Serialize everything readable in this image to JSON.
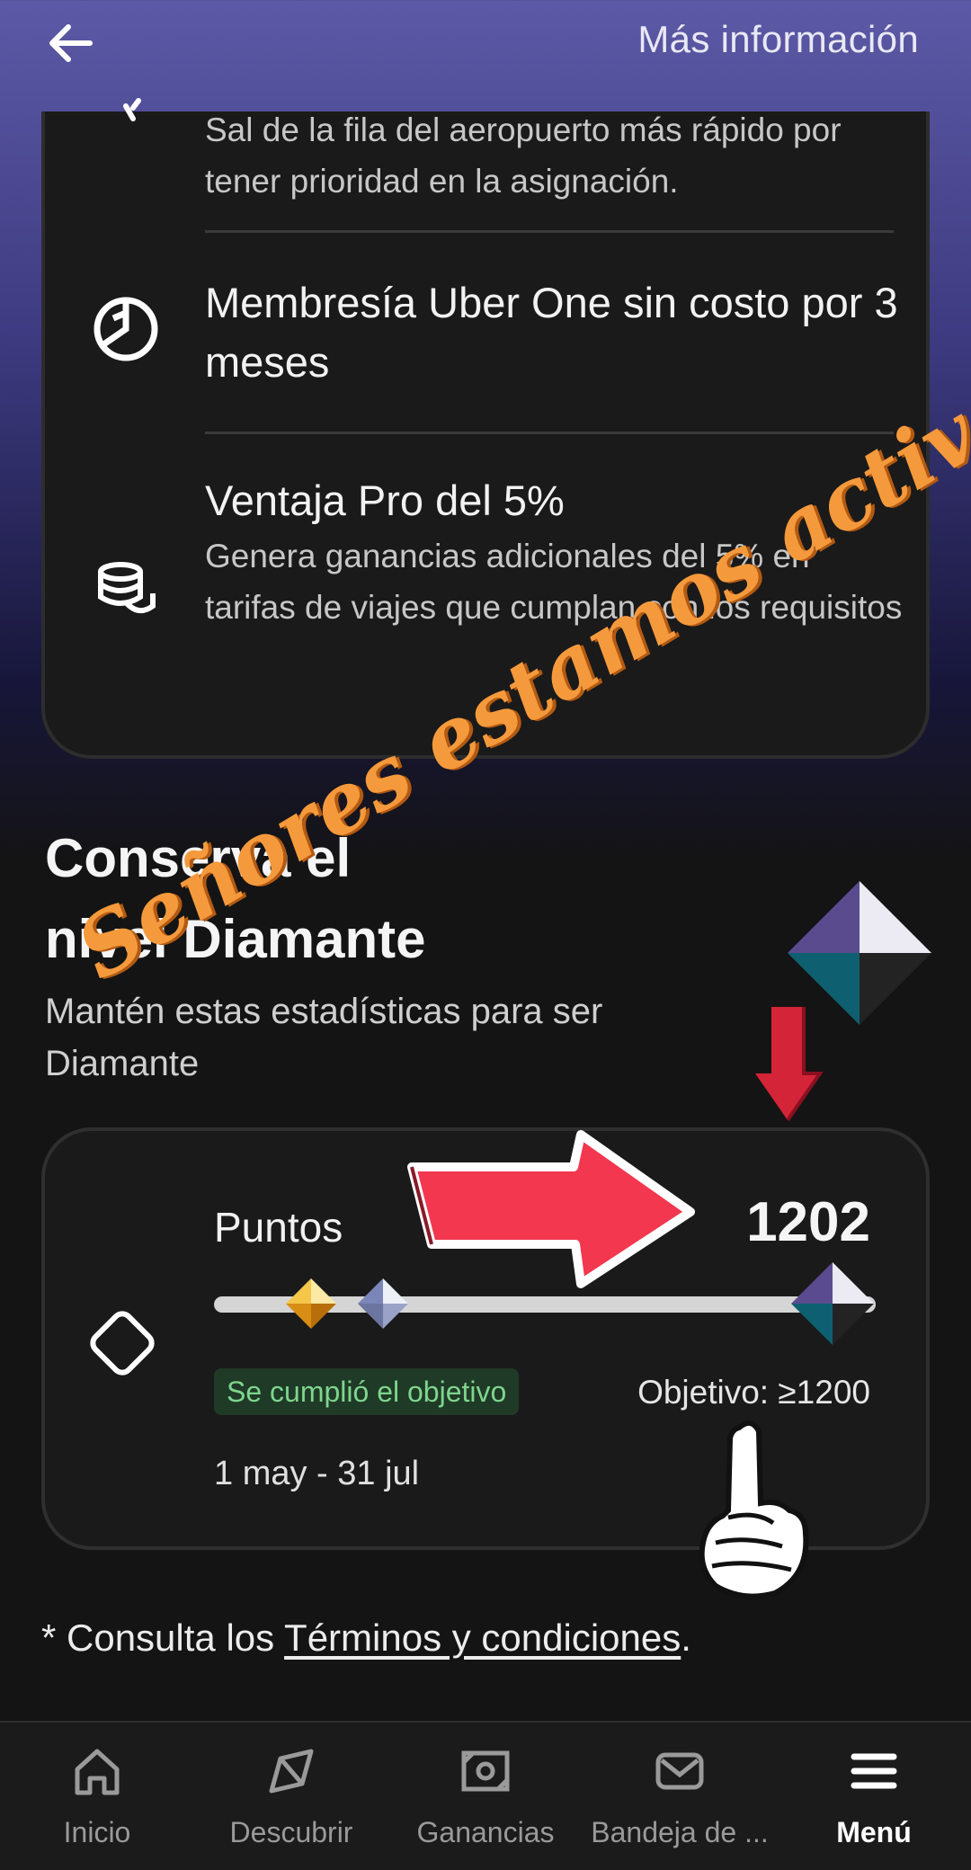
{
  "header": {
    "back_icon": "arrow-left-icon",
    "more_info_label": "Más información"
  },
  "benefits": [
    {
      "icon": "check-icon",
      "title": "",
      "description": "Sal de la fila del aeropuerto más rápido por tener prioridad en la asignación."
    },
    {
      "icon": "uber-one-icon",
      "title": "Membresía Uber One sin costo por 3 meses",
      "description": ""
    },
    {
      "icon": "coins-icon",
      "title": "Ventaja Pro del 5%",
      "description": "Genera ganancias adicionales del 5% en tarifas de viajes que cumplan con los requisitos"
    }
  ],
  "tier_section": {
    "title_line1": "Conserva el",
    "title_line2": "nivel Diamante",
    "subtitle": "Mantén estas estadísticas para ser Diamante",
    "tier_icon": "diamond-tier-icon"
  },
  "points_card": {
    "icon": "diamond-outline-icon",
    "label": "Puntos",
    "value": "1202",
    "status_badge": "Se cumplió el objetivo",
    "goal": "Objetivo: ≥1200",
    "period": "1 may - 31 jul",
    "progress_fraction": 1.0,
    "markers": [
      "gold-tier-marker",
      "platinum-tier-marker",
      "diamond-tier-marker"
    ]
  },
  "terms": {
    "prefix": "* Consulta los ",
    "link": "Términos y condiciones",
    "suffix": "."
  },
  "bottom_nav": [
    {
      "label": "Inicio",
      "icon": "home-icon",
      "active": false
    },
    {
      "label": "Descubrir",
      "icon": "compass-icon",
      "active": false
    },
    {
      "label": "Ganancias",
      "icon": "earnings-icon",
      "active": false
    },
    {
      "label": "Bandeja de ...",
      "icon": "mail-icon",
      "active": false
    },
    {
      "label": "Menú",
      "icon": "menu-icon",
      "active": true
    }
  ],
  "overlay": {
    "caption": "Señores estamos activo",
    "arrow_icons": [
      "red-arrow-right-icon",
      "red-arrow-down-icon"
    ],
    "hand_icon": "pointing-hand-icon"
  },
  "colors": {
    "accent_orange": "#f59a3c",
    "arrow_red": "#f2374f",
    "success_green": "#7ed58e",
    "card_bg": "#1a1a1a"
  }
}
